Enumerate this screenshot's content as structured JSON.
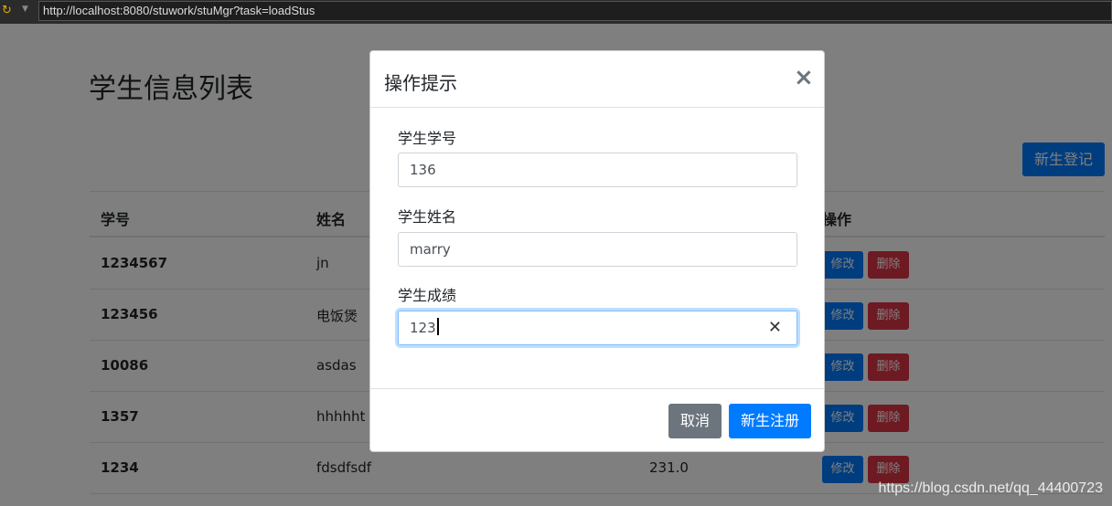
{
  "browser": {
    "url": "http://localhost:8080/stuwork/stuMgr?task=loadStus"
  },
  "page": {
    "title": "学生信息列表",
    "register_button": "新生登记",
    "columns": [
      "学号",
      "姓名",
      "操作"
    ],
    "rows": [
      {
        "id": "1234567",
        "name": "jn",
        "score": ""
      },
      {
        "id": "123456",
        "name": "电饭煲",
        "score": ""
      },
      {
        "id": "10086",
        "name": "asdas",
        "score": ""
      },
      {
        "id": "1357",
        "name": "hhhhht",
        "score": ""
      },
      {
        "id": "1234",
        "name": "fdsdfsdf",
        "score": "231.0"
      }
    ],
    "edit_label": "修改",
    "delete_label": "删除"
  },
  "modal": {
    "title": "操作提示",
    "close_glyph": "×",
    "fields": [
      {
        "label": "学生学号",
        "value": "136"
      },
      {
        "label": "学生姓名",
        "value": "marry"
      },
      {
        "label": "学生成绩",
        "value": "123"
      }
    ],
    "clear_glyph": "✕",
    "cancel_label": "取消",
    "submit_label": "新生注册"
  },
  "watermark": "https://blog.csdn.net/qq_44400723"
}
